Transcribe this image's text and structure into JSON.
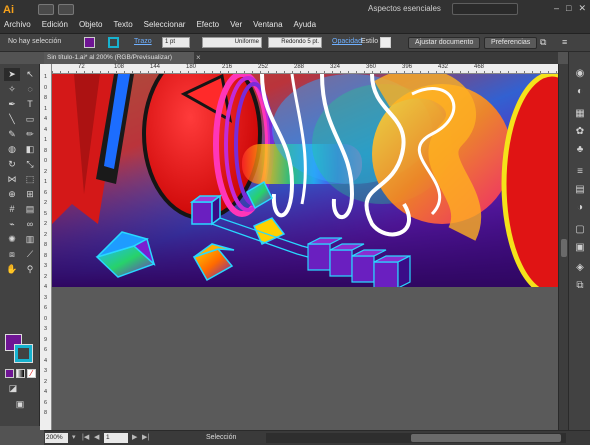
{
  "app": {
    "logo": "Ai",
    "workspace": "Aspectos esenciales"
  },
  "menu": [
    "Archivo",
    "Edición",
    "Objeto",
    "Texto",
    "Seleccionar",
    "Efecto",
    "Ver",
    "Ventana",
    "Ayuda"
  ],
  "control_bar": {
    "selection_status": "No hay selección",
    "stroke_label": "Trazo",
    "stroke_weight": "1 pt",
    "stroke_profile": "Uniforme",
    "brush": "Redondo 5 pt.",
    "opacity_label": "Opacidad",
    "style_label": "Estilo",
    "doc_setup_button": "Ajustar documento",
    "preferences_button": "Preferencias",
    "fill_color": "#6f1594",
    "stroke_color": "#17b2cf"
  },
  "document": {
    "tab_title": "Sin título-1.ai* al 200% (RGB/Previsualizar)"
  },
  "ruler": {
    "h_ticks": [
      "72",
      "108",
      "144",
      "180",
      "216",
      "252",
      "288",
      "324",
      "360",
      "396",
      "432",
      "468"
    ],
    "v_ticks": [
      "1",
      "0",
      "8",
      "1",
      "4",
      "4",
      "1",
      "8",
      "0",
      "2",
      "1",
      "6",
      "2",
      "5",
      "2",
      "2",
      "8",
      "8",
      "3",
      "2",
      "4",
      "3",
      "6",
      "0",
      "3",
      "9",
      "6",
      "4",
      "3",
      "2",
      "4",
      "6",
      "8"
    ]
  },
  "status": {
    "zoom": "200%",
    "page": "1",
    "tool": "Selección"
  }
}
